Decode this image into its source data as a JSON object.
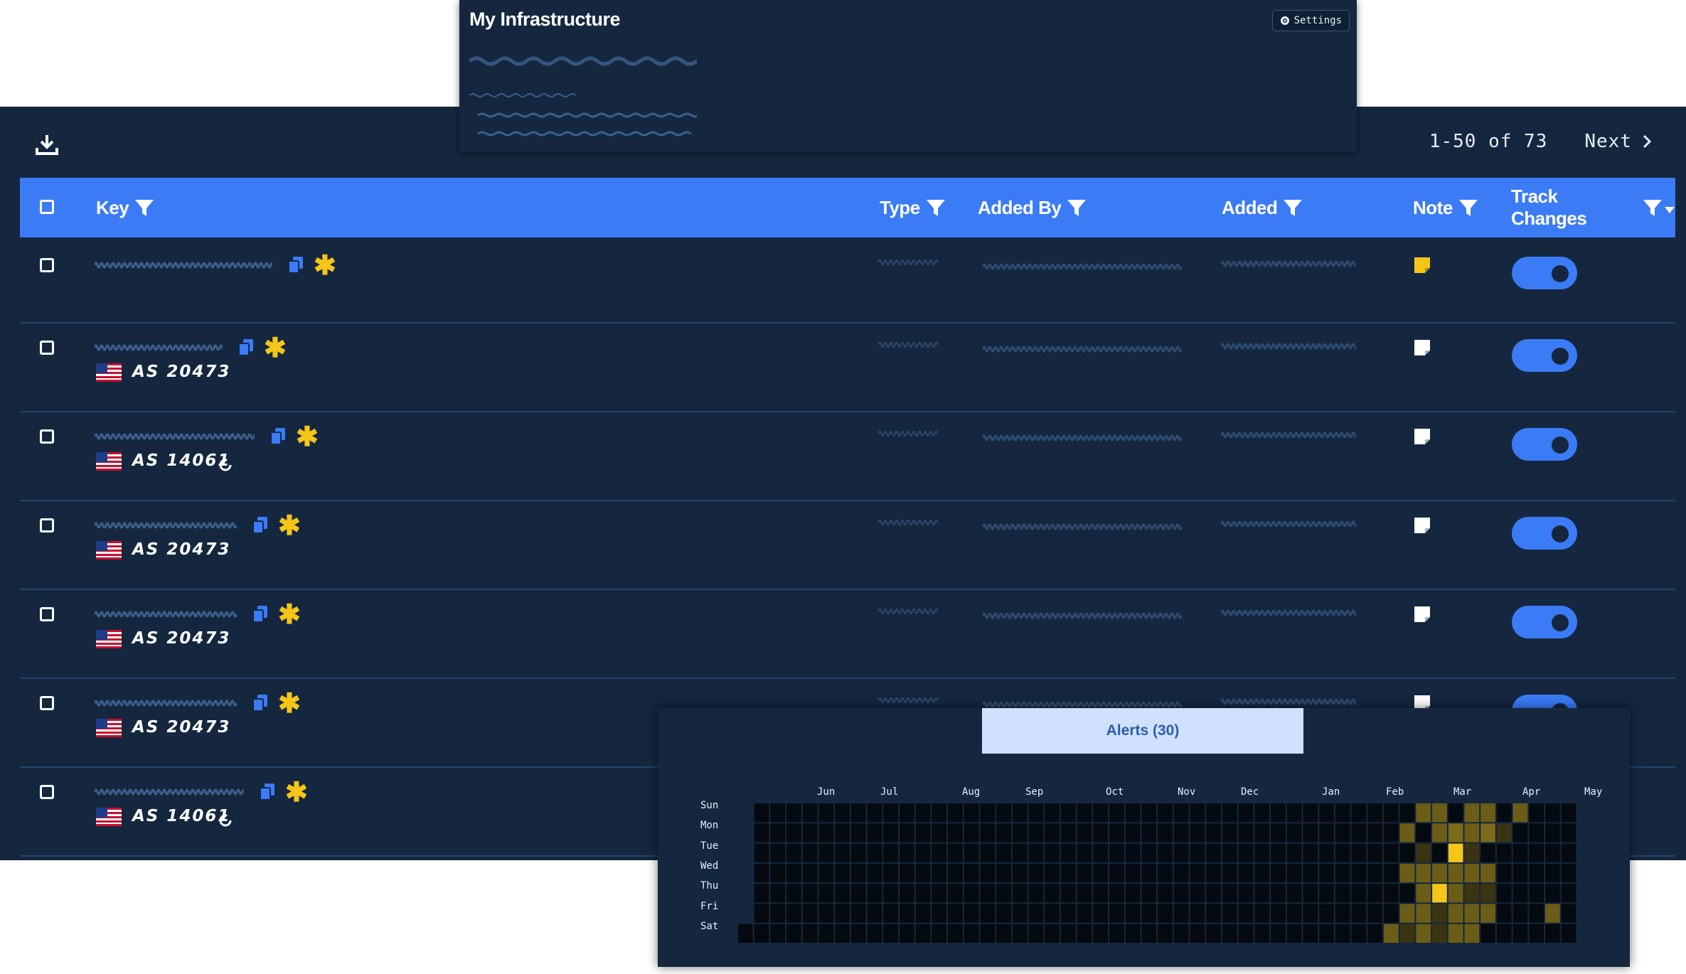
{
  "infrastructure": {
    "title": "My Infrastructure",
    "settings_label": "Settings"
  },
  "pagination": {
    "range": "1-50 of 73",
    "next_label": "Next"
  },
  "table": {
    "columns": {
      "key": "Key",
      "type": "Type",
      "added_by": "Added By",
      "added": "Added",
      "note": "Note",
      "track_changes": "Track Changes"
    },
    "rows": [
      {
        "asn": "",
        "note_color": "#f5c518",
        "track_changes": true
      },
      {
        "asn": "AS 20473",
        "note_color": "#ffffff",
        "track_changes": true
      },
      {
        "asn": "AS 14061",
        "note_color": "#ffffff",
        "track_changes": true
      },
      {
        "asn": "AS 20473",
        "note_color": "#ffffff",
        "track_changes": true
      },
      {
        "asn": "AS 20473",
        "note_color": "#ffffff",
        "track_changes": true
      },
      {
        "asn": "AS 20473",
        "note_color": "#ffffff",
        "track_changes": true
      },
      {
        "asn": "AS 14061",
        "note_color": "#ffffff",
        "track_changes": true
      }
    ]
  },
  "alerts": {
    "tab_label": "Alerts (30)",
    "months": [
      "Jun",
      "Jul",
      "Aug",
      "Sep",
      "Oct",
      "Nov",
      "Dec",
      "Jan",
      "Feb",
      "Mar",
      "Apr",
      "May"
    ],
    "days": [
      "Sun",
      "Mon",
      "Tue",
      "Wed",
      "Thu",
      "Fri",
      "Sat"
    ]
  },
  "colors": {
    "accent": "#3b7bf6",
    "background": "#14273f",
    "star": "#f5c518"
  }
}
